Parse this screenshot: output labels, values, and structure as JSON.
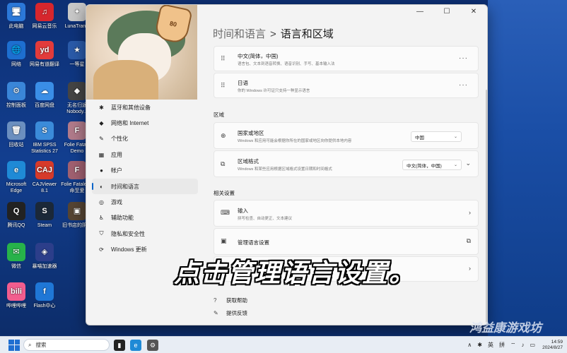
{
  "desktop_icons": [
    {
      "label": "此电脑",
      "glyph": "🖥",
      "color": "#2b78d8"
    },
    {
      "label": "网易云音乐",
      "glyph": "♫",
      "color": "#d6262d"
    },
    {
      "label": "LunaTransl",
      "glyph": "✦",
      "color": "#c7c7c7"
    },
    {
      "label": "网络",
      "glyph": "🌐",
      "color": "#1d6fd0"
    },
    {
      "label": "网易有道翻译",
      "glyph": "yd",
      "color": "#e23b3b"
    },
    {
      "label": "一等星",
      "glyph": "★",
      "color": "#2a5aa8"
    },
    {
      "label": "控制面板",
      "glyph": "⚙",
      "color": "#3a86d8"
    },
    {
      "label": "百度网盘",
      "glyph": "☁",
      "color": "#3a8ee6"
    },
    {
      "label": "无名归途 Nobody...",
      "glyph": "◆",
      "color": "#444"
    },
    {
      "label": "回收站",
      "glyph": "🗑",
      "color": "#6b8fbf"
    },
    {
      "label": "IBM SPSS Statistics 27",
      "glyph": "S",
      "color": "#3b8bd9"
    },
    {
      "label": "Folie Fatale Demo",
      "glyph": "F",
      "color": "#b07a8a"
    },
    {
      "label": "Microsoft Edge",
      "glyph": "e",
      "color": "#1f8ad6"
    },
    {
      "label": "CAJViewer 8.1",
      "glyph": "CAJ",
      "color": "#d63a2a"
    },
    {
      "label": "Folie Fatale 致命至爱",
      "glyph": "F",
      "color": "#a06070"
    },
    {
      "label": "腾讯QQ",
      "glyph": "Q",
      "color": "#222"
    },
    {
      "label": "Steam",
      "glyph": "S",
      "color": "#1b2838"
    },
    {
      "label": "旧书店的阴影",
      "glyph": "▣",
      "color": "#554433"
    },
    {
      "label": "微信",
      "glyph": "✉",
      "color": "#27b24a"
    },
    {
      "label": "暴喵加速器",
      "glyph": "◈",
      "color": "#2c3e8a"
    },
    {
      "label": "哔哩哔哩",
      "glyph": "bili",
      "color": "#f25d8e"
    },
    {
      "label": "Flash中心",
      "glyph": "f",
      "color": "#1f77d6"
    }
  ],
  "window": {
    "avatar_hat_text": "80",
    "controls": {
      "minimize": "—",
      "maximize": "☐",
      "close": "✕"
    }
  },
  "sidebar": {
    "items": [
      {
        "label": "蓝牙和其他设备",
        "icon": "bluetooth-icon",
        "glyph": "✱",
        "active": false
      },
      {
        "label": "网络和 Internet",
        "icon": "wifi-icon",
        "glyph": "◆",
        "active": false
      },
      {
        "label": "个性化",
        "icon": "brush-icon",
        "glyph": "✎",
        "active": false
      },
      {
        "label": "应用",
        "icon": "apps-icon",
        "glyph": "▦",
        "active": false
      },
      {
        "label": "帐户",
        "icon": "account-icon",
        "glyph": "●",
        "active": false
      },
      {
        "label": "时间和语言",
        "icon": "globe-clock-icon",
        "glyph": "◐",
        "active": true
      },
      {
        "label": "游戏",
        "icon": "gamepad-icon",
        "glyph": "◎",
        "active": false
      },
      {
        "label": "辅助功能",
        "icon": "accessibility-icon",
        "glyph": "♿",
        "active": false
      },
      {
        "label": "隐私和安全性",
        "icon": "shield-icon",
        "glyph": "⛉",
        "active": false
      },
      {
        "label": "Windows 更新",
        "icon": "update-icon",
        "glyph": "⟳",
        "active": false
      }
    ]
  },
  "breadcrumb": {
    "parent": "时间和语言",
    "separator": ">",
    "current": "语言和区域"
  },
  "languages": [
    {
      "title": "中文(简体，中国)",
      "desc": "语言包、文本到语音转换、语音识别、手写、基本输入法",
      "drag_glyph": "⠿",
      "more": "···"
    },
    {
      "title": "日语",
      "desc": "你的 Windows 许可证只支持一种显示语言",
      "drag_glyph": "⠿",
      "more": "···"
    }
  ],
  "region": {
    "heading": "区域",
    "country": {
      "title": "国家或地区",
      "desc": "Windows 和应用可能会根据你所在的国家或地区向你提供本地内容",
      "value": "中国",
      "caret": "⌄"
    },
    "format": {
      "title": "区域格式",
      "desc": "Windows 和某些应用根据区域格式设置日期和时间格式",
      "value": "中文(简体，中国)",
      "caret": "⌄",
      "expand": "⌄"
    }
  },
  "related": {
    "heading": "相关设置",
    "input": {
      "title": "输入",
      "desc": "拼写检查、自动更正、文本建议",
      "chev": "›"
    },
    "admin": {
      "title": "管理语言设置",
      "open": "⧉"
    },
    "third": {
      "chev": "›"
    }
  },
  "links": [
    {
      "label": "获取帮助",
      "glyph": "?"
    },
    {
      "label": "提供反馈",
      "glyph": "✎"
    }
  ],
  "caption": "点击管理语言设置。",
  "watermark": "鸿益康游戏坊",
  "taskbar": {
    "search_placeholder": "搜索",
    "search_glyph": "⌕",
    "apps": [
      {
        "name": "desktop-app",
        "glyph": "▮",
        "color": "#222"
      },
      {
        "name": "edge-app",
        "glyph": "e",
        "color": "#1f8ad6"
      },
      {
        "name": "settings-app",
        "glyph": "⚙",
        "color": "#555"
      }
    ],
    "tray": {
      "chevron": "∧",
      "bluetooth": "✱",
      "ime": "英",
      "layout": "拼",
      "network": "⌔",
      "volume": "♪",
      "battery": "▭"
    },
    "time": "14:59",
    "date": "2024/8/27"
  }
}
